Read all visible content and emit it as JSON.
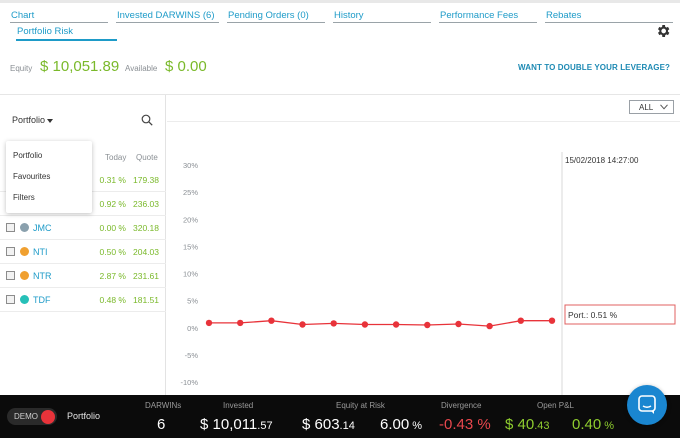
{
  "tabs": [
    {
      "label": "Chart"
    },
    {
      "label": "Invested DARWINS (6)"
    },
    {
      "label": "Pending Orders (0)"
    },
    {
      "label": "History"
    },
    {
      "label": "Performance Fees"
    },
    {
      "label": "Rebates"
    },
    {
      "label": "Portfolio Risk"
    }
  ],
  "equity": {
    "equity_label": "Equity",
    "equity_value": "$ 10,051.89",
    "available_label": "Available",
    "available_value": "$ 0.00",
    "leverage_link": "WANT TO DOUBLE YOUR LEVERAGE?"
  },
  "left_panel": {
    "portfolio_select": "Portfolio",
    "col_today": "Today",
    "col_quote": "Quote",
    "rows": [
      {
        "name": "",
        "today": "0.31 %",
        "quote": "179.38",
        "dot": "#f0a030"
      },
      {
        "name": "",
        "today": "0.92 %",
        "quote": "236.03",
        "dot": "#f0a030"
      },
      {
        "name": "JMC",
        "today": "0.00 %",
        "quote": "320.18",
        "dot": "#8aa0ad"
      },
      {
        "name": "NTI",
        "today": "0.50 %",
        "quote": "204.03",
        "dot": "#f0a030"
      },
      {
        "name": "NTR",
        "today": "2.87 %",
        "quote": "231.61",
        "dot": "#f0a030"
      },
      {
        "name": "TDF",
        "today": "0.48 %",
        "quote": "181.51",
        "dot": "#26c0b8"
      }
    ],
    "dropdown": [
      "Portfolio",
      "Favourites",
      "Filters"
    ]
  },
  "chart_controls": {
    "range_select": "ALL"
  },
  "chart_data": {
    "type": "line",
    "y_ticks": [
      "30%",
      "25%",
      "20%",
      "15%",
      "10%",
      "5%",
      "0%",
      "-5%",
      "-10%"
    ],
    "ylim": [
      -10,
      30
    ],
    "values": [
      0.9,
      0.9,
      1.3,
      0.6,
      0.8,
      0.6,
      0.6,
      0.5,
      0.7,
      0.3,
      1.3,
      1.3
    ],
    "tooltip_date": "15/02/2018 14:27:00",
    "tooltip_value": "Port.: 0.51 %",
    "line_color": "#e8333a",
    "grid": false
  },
  "bottom_bar": {
    "demo_label": "DEMO",
    "portfolio_label": "Portfolio",
    "darwins_label": "DARWINs",
    "darwins_value": "6",
    "invested_label": "Invested",
    "invested_main": "$ 10,011",
    "invested_cents": ".57",
    "risk_label": "Equity at Risk",
    "risk_main": "$ 603",
    "risk_cents": ".14",
    "risk_pct_main": "6.00",
    "risk_pct_unit": " %",
    "divergence_label": "Divergence",
    "divergence_value": "-0.43 %",
    "pnl_label": "Open P&L",
    "pnl_main": "$ 40",
    "pnl_cents": ".43",
    "pnl_pct_main": "0.40",
    "pnl_pct_unit": " %"
  },
  "colors": {
    "accent": "#1e9bc8",
    "positive": "#7ab92a",
    "negative": "#e8474d"
  }
}
